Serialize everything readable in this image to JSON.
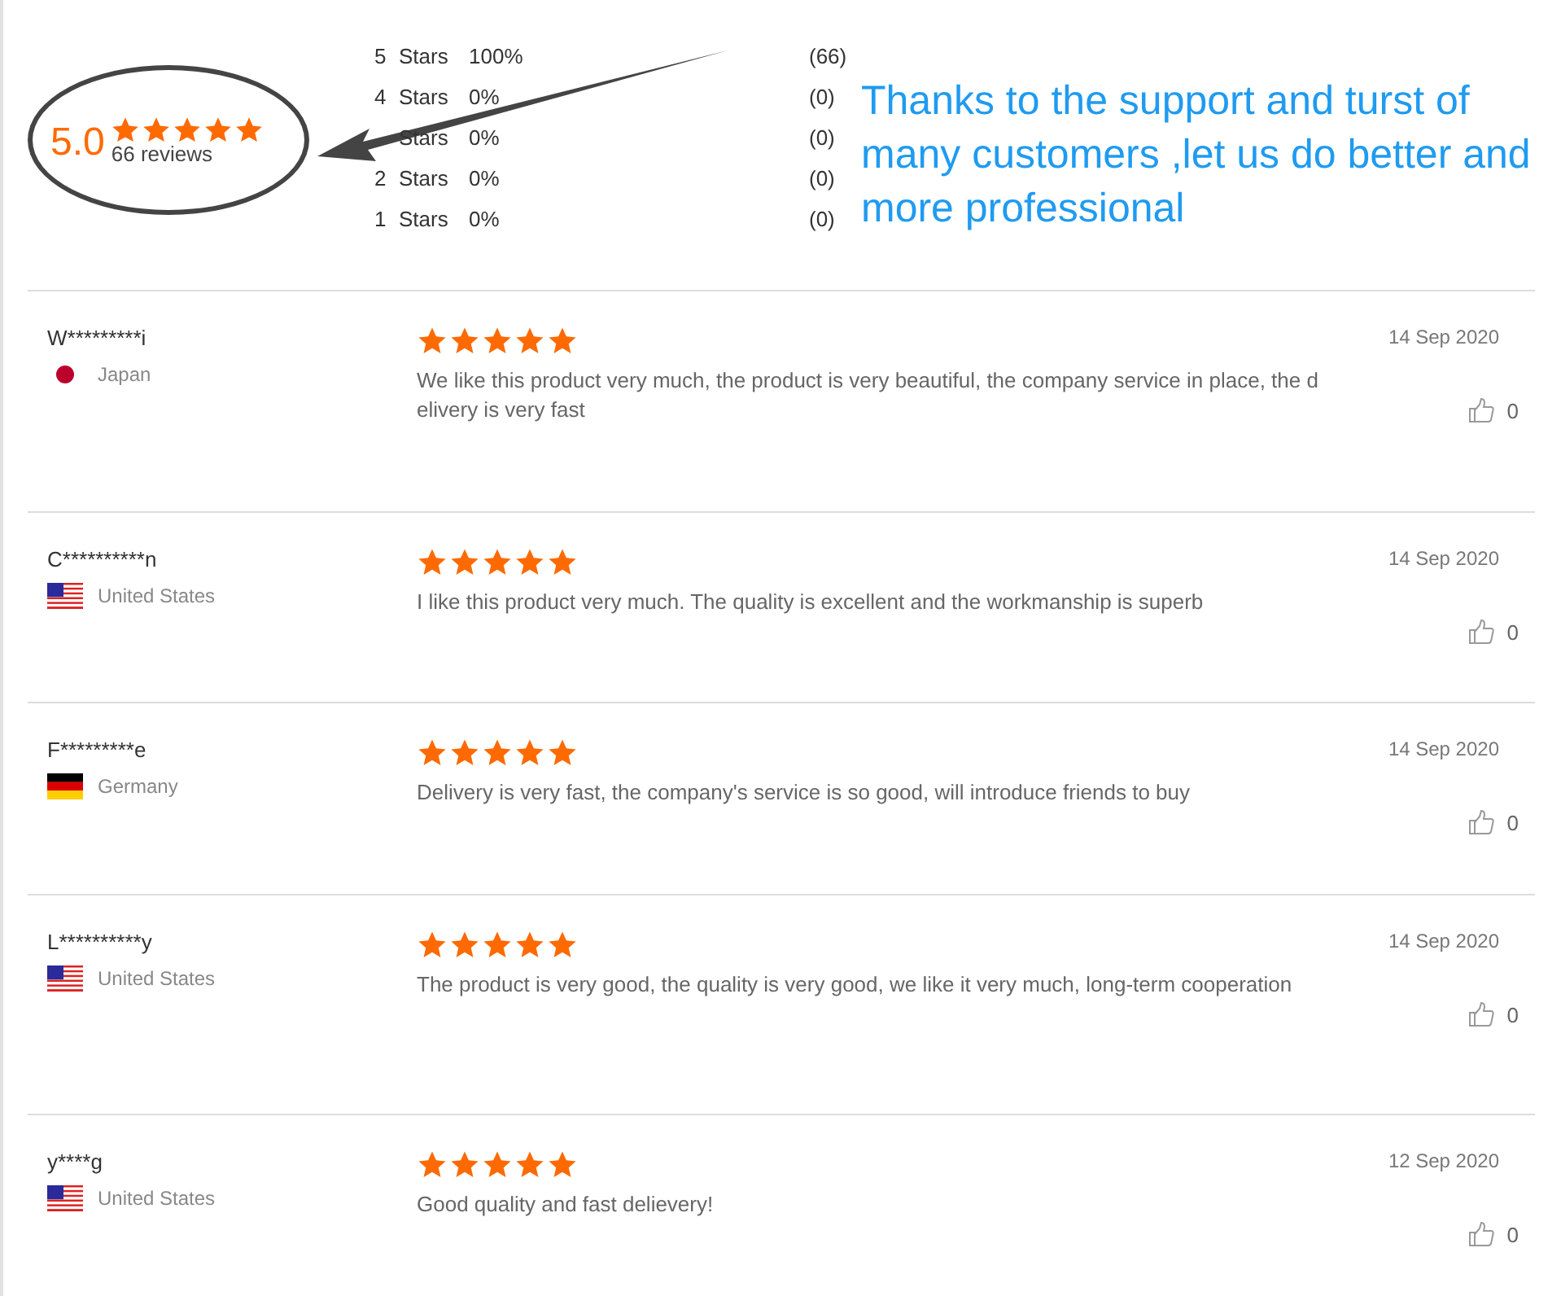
{
  "summary": {
    "score": "5.0",
    "stars": 5,
    "reviews": "66 reviews"
  },
  "distribution": [
    {
      "number": "5",
      "label": "Stars",
      "percent": "100%",
      "count": "(66)"
    },
    {
      "number": "4",
      "label": "Stars",
      "percent": "0%",
      "count": "(0)"
    },
    {
      "label": "Stars",
      "percent": "0%",
      "count": "(0)"
    },
    {
      "number": "2",
      "label": "Stars",
      "percent": "0%",
      "count": "(0)"
    },
    {
      "number": "1",
      "label": "Stars",
      "percent": "0%",
      "count": "(0)"
    }
  ],
  "annotation": {
    "text": "Thanks to the support and turst of many customers ,let us do better and more professional"
  },
  "reviews": [
    {
      "name": "W*********i",
      "kind": "jp",
      "country": "Japan",
      "stars": 5,
      "text": "We like this product very much, the product is very beautiful, the company service in place, the delivery is very fast",
      "date": "14 Sep 2020",
      "likes": "0"
    },
    {
      "name": "C**********n",
      "kind": "us",
      "country": "United States",
      "stars": 5,
      "text": "I like this product very much. The quality is excellent and the workmanship is superb",
      "date": "14 Sep 2020",
      "likes": "0"
    },
    {
      "name": "F*********e",
      "kind": "de",
      "country": "Germany",
      "stars": 5,
      "text": "Delivery is very fast, the company's service is so good, will introduce friends to buy",
      "date": "14 Sep 2020",
      "likes": "0"
    },
    {
      "name": "L**********y",
      "kind": "us",
      "country": "United States",
      "stars": 5,
      "text": "The product is very good, the quality is very good, we like it very much, long-term cooperation",
      "date": "14 Sep 2020",
      "likes": "0"
    },
    {
      "name": "y****g",
      "kind": "us",
      "country": "United States",
      "stars": 5,
      "text": "Good quality and fast delievery!",
      "date": "12 Sep 2020",
      "likes": "0"
    }
  ]
}
